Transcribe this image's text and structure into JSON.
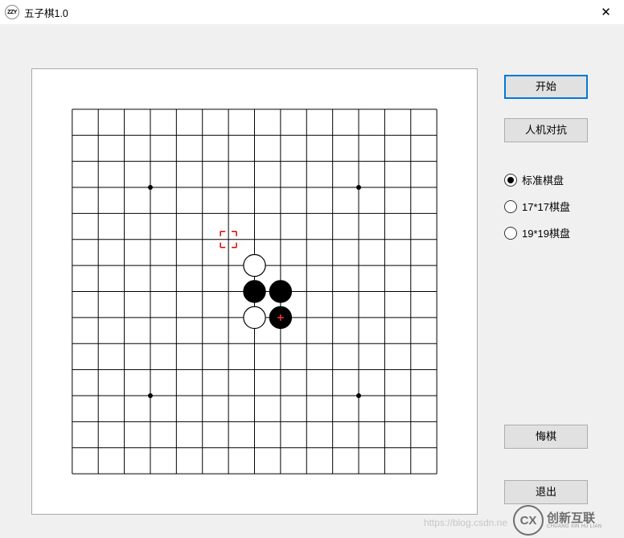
{
  "window": {
    "title": "五子棋1.0",
    "close_glyph": "✕",
    "app_icon_text": "ZZY"
  },
  "buttons": {
    "start": "开始",
    "mode": "人机对抗",
    "undo": "悔棋",
    "exit": "退出"
  },
  "radios": {
    "options": [
      {
        "label": "标准棋盘",
        "value": "standard",
        "checked": true
      },
      {
        "label": "17*17棋盘",
        "value": "17",
        "checked": false
      },
      {
        "label": "19*19棋盘",
        "value": "19",
        "checked": false
      }
    ],
    "selected": "standard"
  },
  "board": {
    "size": 15,
    "star_points": [
      {
        "col": 3,
        "row": 3
      },
      {
        "col": 11,
        "row": 3
      },
      {
        "col": 7,
        "row": 7
      },
      {
        "col": 3,
        "row": 11
      },
      {
        "col": 11,
        "row": 11
      }
    ],
    "stones": [
      {
        "col": 7,
        "row": 6,
        "color": "white"
      },
      {
        "col": 7,
        "row": 7,
        "color": "black"
      },
      {
        "col": 8,
        "row": 7,
        "color": "black"
      },
      {
        "col": 7,
        "row": 8,
        "color": "white"
      },
      {
        "col": 8,
        "row": 8,
        "color": "black",
        "last": true
      }
    ],
    "hover": {
      "col": 6,
      "row": 5
    }
  },
  "watermark": {
    "text_url": "https://blog.csdn.ne",
    "logo_abbr": "CX",
    "logo_cn": "创新互联",
    "logo_en": "CHUANG XIN HU LIAN"
  }
}
